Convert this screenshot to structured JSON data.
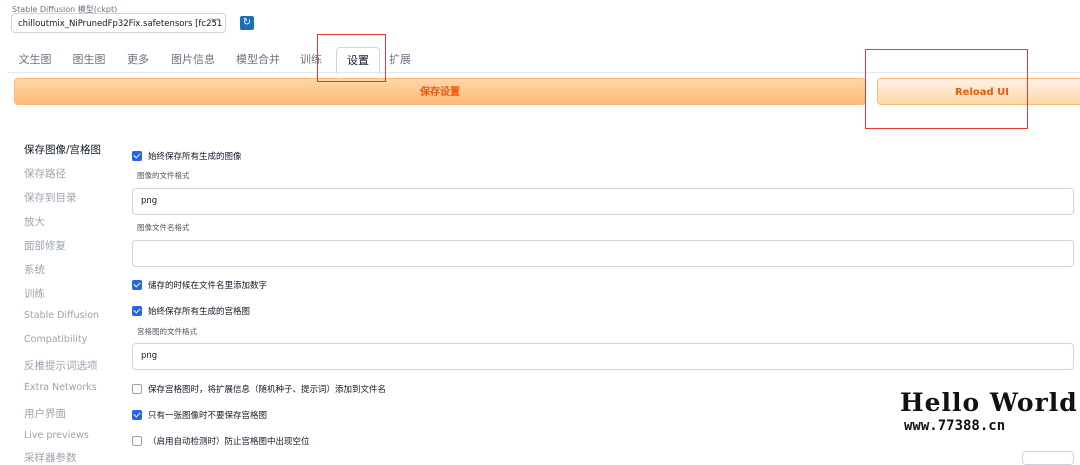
{
  "header": {
    "model_label": "Stable Diffusion 模型(ckpt)",
    "model_value": "chilloutmix_NiPrunedFp32Fix.safetensors [fc251",
    "refresh_icon": "refresh-icon"
  },
  "tabs": [
    "文生图",
    "图生图",
    "更多",
    "图片信息",
    "模型合并",
    "训练",
    "设置",
    "扩展"
  ],
  "active_tab": "设置",
  "actions": {
    "save_label": "保存设置",
    "reload_label": "Reload UI"
  },
  "sidebar": [
    "保存图像/宫格图",
    "保存路径",
    "保存到目录",
    "放大",
    "面部修复",
    "系统",
    "训练",
    "Stable Diffusion",
    "Compatibility",
    "反推提示词选项",
    "Extra Networks",
    "用户界面",
    "Live previews",
    "采样器参数"
  ],
  "settings": {
    "always_save_images": {
      "label": "始终保存所有生成的图像",
      "checked": true
    },
    "image_format_label": "图像的文件格式",
    "image_format_value": "png",
    "image_filename_pattern_label": "图像文件名格式",
    "image_filename_pattern_value": "",
    "add_number_to_filename": {
      "label": "储存的时候在文件名里添加数字",
      "checked": true
    },
    "always_save_grids": {
      "label": "始终保存所有生成的宫格图",
      "checked": true
    },
    "grid_format_label": "宫格图的文件格式",
    "grid_format_value": "png",
    "grid_extended_filename": {
      "label": "保存宫格图时，将扩展信息（随机种子、提示词）添加到文件名",
      "checked": false
    },
    "grid_only_if_multiple": {
      "label": "只有一张图像时不要保存宫格图",
      "checked": true
    },
    "grid_prevent_empty_spots": {
      "label": "（启用自动检测时）防止宫格图中出现空位",
      "checked": false
    }
  },
  "watermark": {
    "title": "Hello World",
    "url": "www.77388.cn"
  },
  "colors": {
    "accent": "#2563eb",
    "highlight": "#e53935",
    "button_orange": "#ea580c"
  }
}
